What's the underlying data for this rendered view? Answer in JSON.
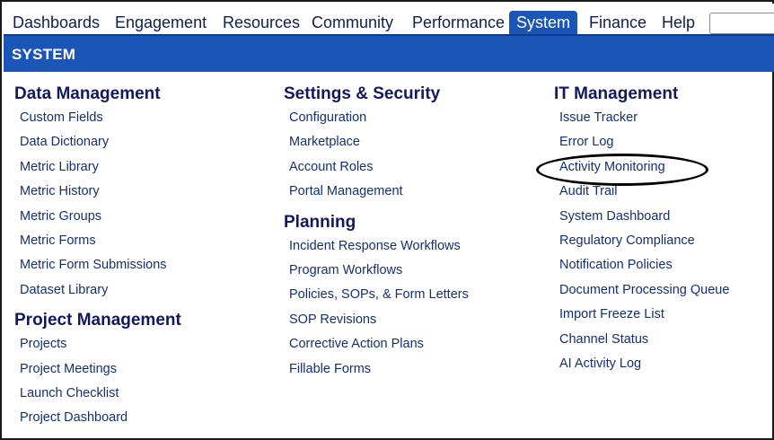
{
  "nav": {
    "tabs": [
      {
        "label": "Dashboards"
      },
      {
        "label": "Engagement"
      },
      {
        "label": "Resources"
      },
      {
        "label": "Community"
      },
      {
        "label": "Performance"
      },
      {
        "label": "System"
      },
      {
        "label": "Finance"
      },
      {
        "label": "Help"
      }
    ],
    "active_tab": "System",
    "search": {
      "value": "",
      "placeholder": ""
    }
  },
  "banner": {
    "title": "SYSTEM"
  },
  "columns": [
    {
      "groups": [
        {
          "title": "Data Management",
          "items": [
            "Custom Fields",
            "Data Dictionary",
            "Metric Library",
            "Metric History",
            "Metric Groups",
            "Metric Forms",
            "Metric Form Submissions",
            "Dataset Library"
          ]
        },
        {
          "title": "Project Management",
          "items": [
            "Projects",
            "Project Meetings",
            "Launch Checklist",
            "Project Dashboard"
          ]
        }
      ]
    },
    {
      "groups": [
        {
          "title": "Settings & Security",
          "items": [
            "Configuration",
            "Marketplace",
            "Account Roles",
            "Portal Management"
          ]
        },
        {
          "title": "Planning",
          "items": [
            "Incident Response Workflows",
            "Program Workflows",
            "Policies, SOPs, & Form Letters",
            "SOP Revisions",
            "Corrective Action Plans",
            "Fillable Forms"
          ]
        }
      ]
    },
    {
      "groups": [
        {
          "title": "IT Management",
          "items": [
            "Issue Tracker",
            "Error Log",
            "Activity Monitoring",
            "Audit Trail",
            "System Dashboard",
            "Regulatory Compliance",
            "Notification Policies",
            "Document Processing Queue",
            "Import Freeze List",
            "Channel Status",
            "AI Activity Log"
          ]
        }
      ]
    }
  ],
  "colors": {
    "accent": "#1c55b8",
    "heading": "#12195c",
    "link": "#14306e"
  }
}
